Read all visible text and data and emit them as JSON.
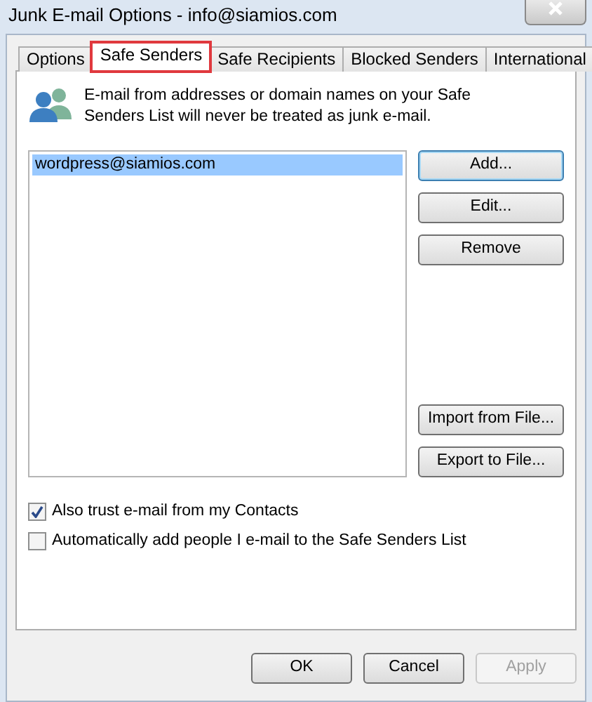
{
  "window": {
    "title": "Junk E-mail Options - info@siamios.com"
  },
  "tabs": [
    {
      "label": "Options",
      "selected": false
    },
    {
      "label": "Safe Senders",
      "selected": true
    },
    {
      "label": "Safe Recipients",
      "selected": false
    },
    {
      "label": "Blocked Senders",
      "selected": false
    },
    {
      "label": "International",
      "selected": false
    }
  ],
  "description": "E-mail from addresses or domain names on your Safe Senders List will never be treated as junk e-mail.",
  "list": [
    {
      "text": "wordpress@siamios.com",
      "selected": true
    }
  ],
  "side_buttons_top": [
    {
      "label": "Add..."
    },
    {
      "label": "Edit..."
    },
    {
      "label": "Remove"
    }
  ],
  "side_buttons_bottom": [
    {
      "label": "Import from File..."
    },
    {
      "label": "Export to File..."
    }
  ],
  "checkboxes": [
    {
      "label": "Also trust e-mail from my Contacts",
      "checked": true
    },
    {
      "label": "Automatically add people I e-mail to the Safe Senders List",
      "checked": false
    }
  ],
  "footer_buttons": [
    {
      "label": "OK",
      "disabled": false
    },
    {
      "label": "Cancel",
      "disabled": false
    },
    {
      "label": "Apply",
      "disabled": true
    }
  ]
}
